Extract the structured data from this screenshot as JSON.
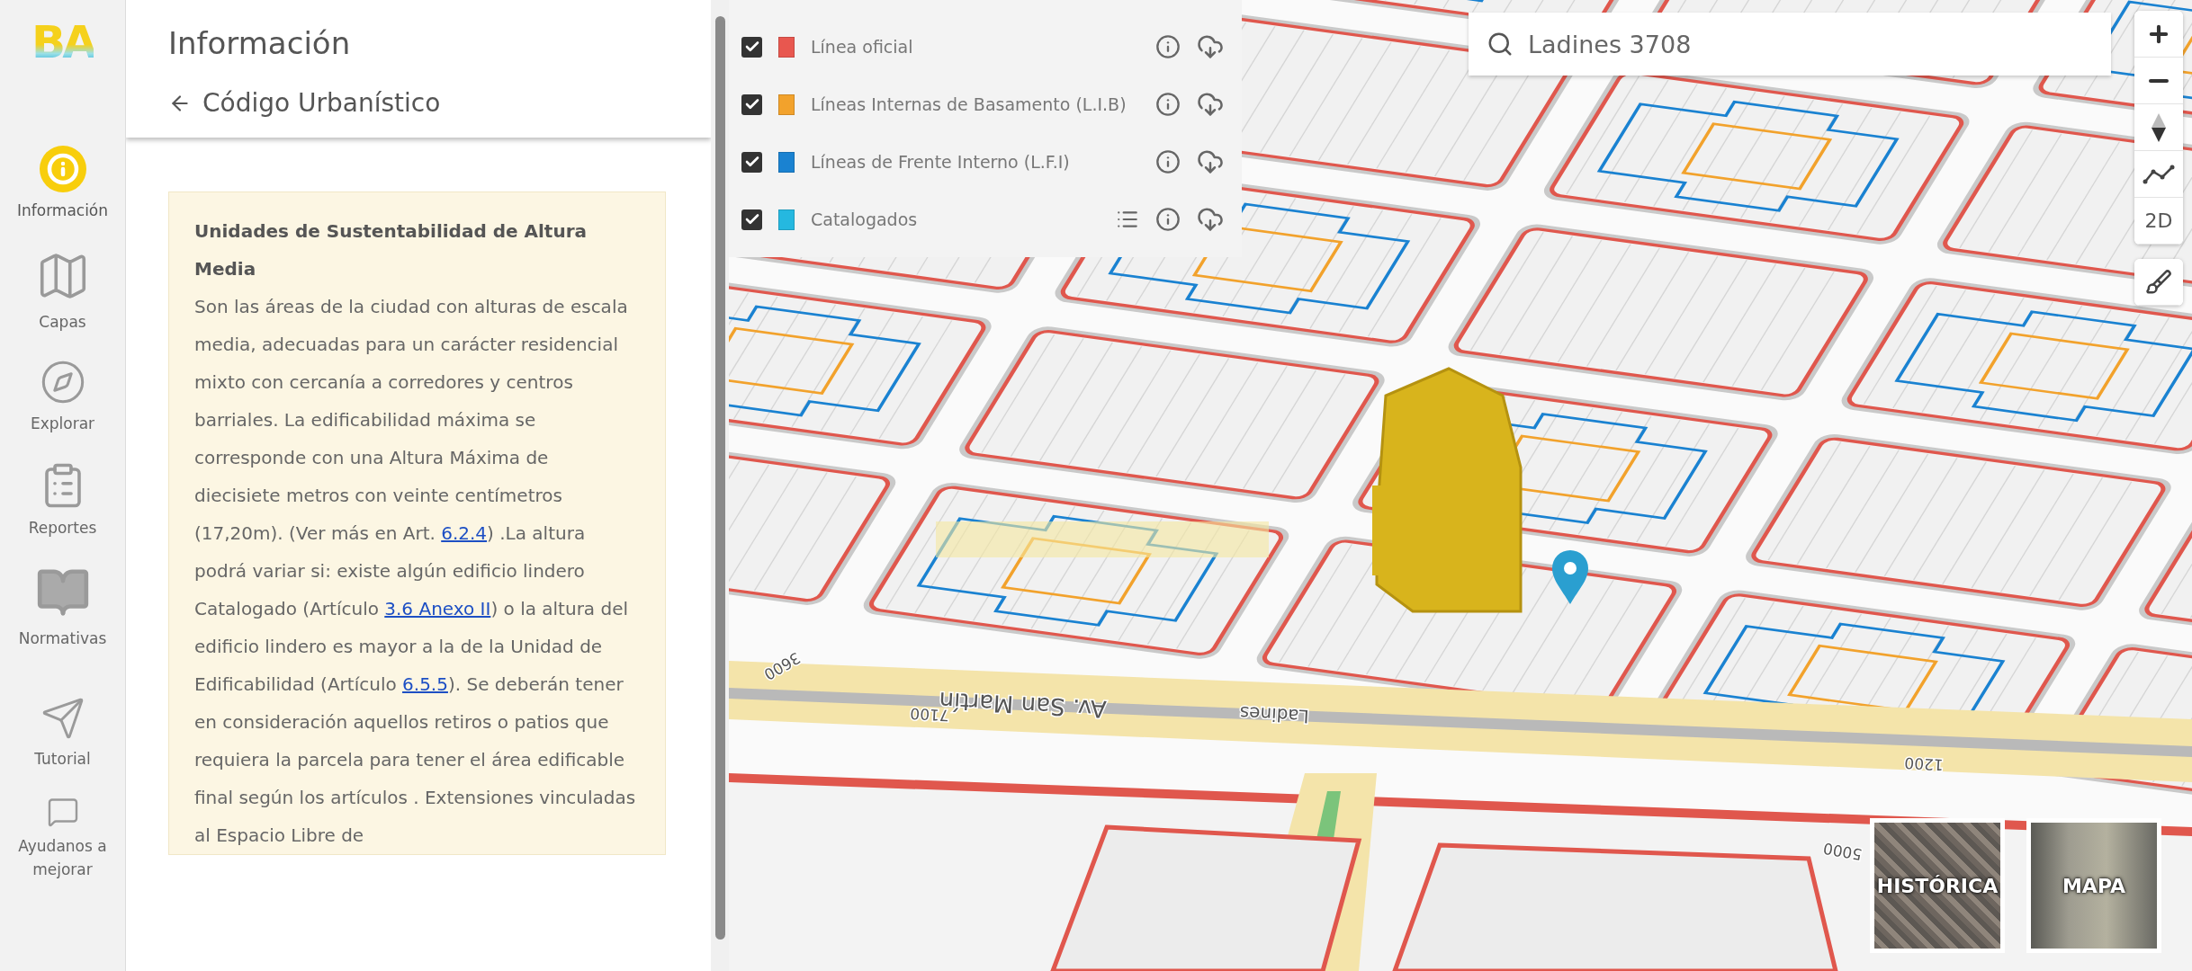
{
  "logo": "BA",
  "sidebar": {
    "items": [
      {
        "label": "Información",
        "kind": "info",
        "selected": true
      },
      {
        "label": "Capas",
        "kind": "layers",
        "selected": false
      },
      {
        "label": "Explorar",
        "kind": "explore",
        "selected": false
      },
      {
        "label": "Reportes",
        "kind": "reports",
        "selected": false
      },
      {
        "label": "Normativas",
        "kind": "rules",
        "selected": false
      },
      {
        "label": "Tutorial",
        "kind": "tutorial",
        "selected": false
      },
      {
        "label": "Ayudanos a mejorar",
        "kind": "feedback",
        "selected": false
      }
    ]
  },
  "panel": {
    "title": "Información",
    "back_label": "Código Urbanístico",
    "card": {
      "title": "Unidades de Sustentabilidad de Altura Media",
      "body": [
        {
          "kind": "text",
          "text": "Son las áreas de la ciudad con alturas de escala media, adecuadas para un carácter residencial mixto con cercanía a corredores y centros barriales. La edificabilidad máxima se corresponde con una Altura Máxima de diecisiete metros con veinte centímetros (17,20m). (Ver más en Art. "
        },
        {
          "kind": "link",
          "text": "6.2.4"
        },
        {
          "kind": "text",
          "text": ") .La altura podrá variar si: existe algún edificio lindero Catalogado (Artículo "
        },
        {
          "kind": "link",
          "text": "3.6 Anexo II"
        },
        {
          "kind": "text",
          "text": ") o la altura del edificio lindero es mayor a la de la Unidad de Edificabilidad (Artículo "
        },
        {
          "kind": "link",
          "text": "6.5.5"
        },
        {
          "kind": "text",
          "text": "). Se deberán tener en consideración aquellos retiros o patios que requiera la parcela para tener el área edificable final según los artículos . Extensiones vinculadas al Espacio Libre de"
        }
      ]
    }
  },
  "layers": [
    {
      "label": "Línea oficial",
      "color": "#e8574f",
      "checked": true,
      "table_icon": false
    },
    {
      "label": "Líneas Internas de Basamento (L.I.B)",
      "color": "#f2a22c",
      "checked": true,
      "table_icon": false
    },
    {
      "label": "Líneas de Frente Interno (L.F.I)",
      "color": "#1a82d1",
      "checked": true,
      "table_icon": false
    },
    {
      "label": "Catalogados",
      "color": "#25b8e0",
      "checked": true,
      "table_icon": true
    }
  ],
  "search": {
    "value": "Ladines 3708"
  },
  "map_controls": [
    {
      "kind": "zoom_in"
    },
    {
      "kind": "zoom_out"
    },
    {
      "kind": "compass"
    },
    {
      "kind": "measure"
    },
    {
      "kind": "mode",
      "label": "2D"
    },
    {
      "kind": "clear"
    }
  ],
  "map_labels": [
    {
      "text": "Av. San Martín",
      "kind": "avenue"
    },
    {
      "text": "Ladines",
      "kind": "street"
    },
    {
      "text": "7100",
      "kind": "number"
    },
    {
      "text": "3600",
      "kind": "number"
    },
    {
      "text": "1200",
      "kind": "number"
    },
    {
      "text": "5000",
      "kind": "number"
    }
  ],
  "basemaps": [
    {
      "label": "HISTÓRICA"
    },
    {
      "label": "MAPA"
    }
  ]
}
